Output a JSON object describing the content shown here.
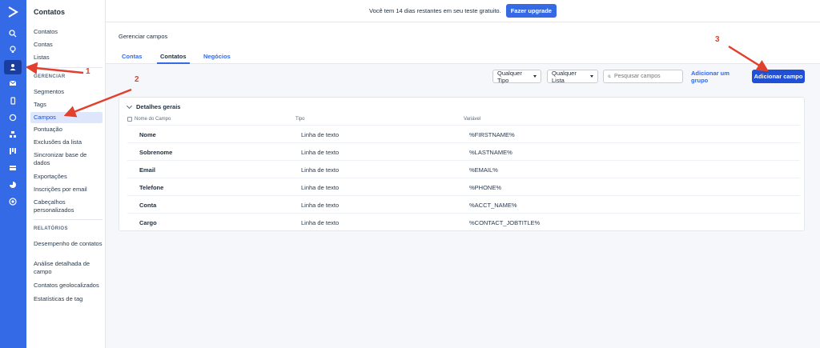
{
  "rail": {
    "icons": [
      "logo-icon",
      "search-icon",
      "lightbulb-icon",
      "contacts-icon",
      "email-icon",
      "mobile-icon",
      "whatsapp-icon",
      "automations-icon",
      "pipelines-icon",
      "lists-icon",
      "reports-icon",
      "plus-icon"
    ],
    "active": "contacts-icon"
  },
  "sidebar": {
    "title": "Contatos",
    "items": [
      "Contatos",
      "Contas",
      "Listas"
    ],
    "section_gerenciar": "GERENCIAR",
    "manage_items": [
      "Segmentos",
      "Tags",
      "Campos",
      "Pontuação",
      "Exclusões da lista",
      "Sincronizar base de dados",
      "Exportações",
      "Inscrições por email",
      "Cabeçalhos personalizados"
    ],
    "section_relatorios": "RELATÓRIOS",
    "report_items": [
      "Desempenho de contatos",
      "Análise detalhada de campo",
      "Contatos geolocalizados",
      "Estatísticas de tag"
    ]
  },
  "trial": {
    "message": "Você tem 14 dias restantes em seu teste gratuito.",
    "button": "Fazer upgrade"
  },
  "header": {
    "title": "Gerenciar campos",
    "tabs": [
      "Contas",
      "Contatos",
      "Negócios"
    ]
  },
  "toolbar": {
    "type_filter": "Qualquer Tipo",
    "list_filter": "Qualquer Lista",
    "search_placeholder": "Pesquisar campos",
    "add_group": "Adicionar um grupo",
    "add_field": "Adicionar campo"
  },
  "group": {
    "title": "Detalhes gerais",
    "columns": [
      "Nome do Campo",
      "Tipo",
      "Variável"
    ],
    "rows": [
      {
        "name": "Nome",
        "type": "Linha de texto",
        "var": "%FIRSTNAME%"
      },
      {
        "name": "Sobrenome",
        "type": "Linha de texto",
        "var": "%LASTNAME%"
      },
      {
        "name": "Email",
        "type": "Linha de texto",
        "var": "%EMAIL%"
      },
      {
        "name": "Telefone",
        "type": "Linha de texto",
        "var": "%PHONE%"
      },
      {
        "name": "Conta",
        "type": "Linha de texto",
        "var": "%ACCT_NAME%"
      },
      {
        "name": "Cargo",
        "type": "Linha de texto",
        "var": "%CONTACT_JOBTITLE%"
      }
    ]
  },
  "annotations": [
    "1",
    "2",
    "3"
  ],
  "colors": {
    "primary": "#356ae6",
    "arrow": "#e1402d"
  }
}
